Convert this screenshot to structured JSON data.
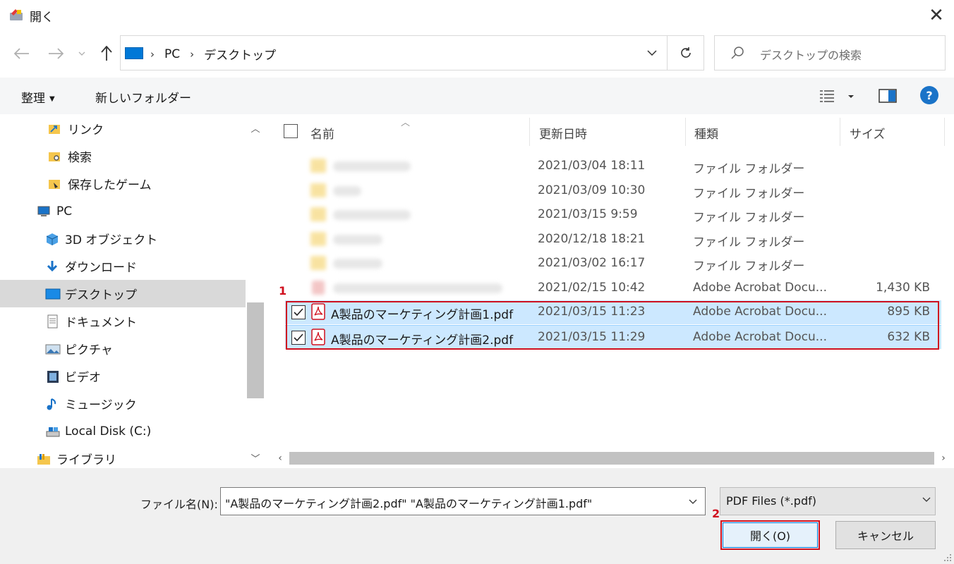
{
  "window": {
    "title": "開く",
    "close_glyph": "✕"
  },
  "address": {
    "crumbs": [
      "PC",
      "デスクトップ"
    ],
    "search_placeholder": "デスクトップの検索"
  },
  "toolbar": {
    "organize_label": "整理",
    "new_folder_label": "新しいフォルダー",
    "help_glyph": "?"
  },
  "nav": {
    "items": [
      {
        "label": "リンク",
        "icon": "links-folder-icon"
      },
      {
        "label": "検索",
        "icon": "search-folder-icon"
      },
      {
        "label": "保存したゲーム",
        "icon": "saved-games-icon"
      },
      {
        "label": "PC",
        "icon": "pc-icon"
      },
      {
        "label": "3D オブジェクト",
        "icon": "3d-objects-icon"
      },
      {
        "label": "ダウンロード",
        "icon": "downloads-icon"
      },
      {
        "label": "デスクトップ",
        "icon": "desktop-icon",
        "selected": true
      },
      {
        "label": "ドキュメント",
        "icon": "documents-icon"
      },
      {
        "label": "ピクチャ",
        "icon": "pictures-icon"
      },
      {
        "label": "ビデオ",
        "icon": "videos-icon"
      },
      {
        "label": "ミュージック",
        "icon": "music-icon"
      },
      {
        "label": "Local Disk (C:)",
        "icon": "local-disk-icon"
      },
      {
        "label": "ライブラリ",
        "icon": "libraries-icon"
      }
    ]
  },
  "columns": {
    "name": "名前",
    "date": "更新日時",
    "type": "種類",
    "size": "サイズ"
  },
  "files": [
    {
      "name": "",
      "date": "2021/03/04 18:11",
      "type": "ファイル フォルダー",
      "size": "",
      "kind": "folder",
      "blurred": true
    },
    {
      "name": "",
      "date": "2021/03/09 10:30",
      "type": "ファイル フォルダー",
      "size": "",
      "kind": "folder",
      "blurred": true
    },
    {
      "name": "",
      "date": "2021/03/15 9:59",
      "type": "ファイル フォルダー",
      "size": "",
      "kind": "folder",
      "blurred": true
    },
    {
      "name": "",
      "date": "2020/12/18 18:21",
      "type": "ファイル フォルダー",
      "size": "",
      "kind": "folder",
      "blurred": true
    },
    {
      "name": "",
      "date": "2021/03/02 16:17",
      "type": "ファイル フォルダー",
      "size": "",
      "kind": "folder",
      "blurred": true
    },
    {
      "name": "",
      "date": "2021/02/15 10:42",
      "type": "Adobe Acrobat Docu...",
      "size": "1,430 KB",
      "kind": "pdf",
      "blurred": true
    },
    {
      "name": "A製品のマーケティング計画1.pdf",
      "date": "2021/03/15 11:23",
      "type": "Adobe Acrobat Docu...",
      "size": "895 KB",
      "kind": "pdf",
      "selected": true
    },
    {
      "name": "A製品のマーケティング計画2.pdf",
      "date": "2021/03/15 11:29",
      "type": "Adobe Acrobat Docu...",
      "size": "632 KB",
      "kind": "pdf",
      "selected": true
    }
  ],
  "markers": {
    "step1": "1",
    "step2": "2"
  },
  "bottom": {
    "filename_label": "ファイル名(N):",
    "filename_value": "\"A製品のマーケティング計画2.pdf\" \"A製品のマーケティング計画1.pdf\"",
    "filter_value": "PDF Files (*.pdf)",
    "open_label": "開く(O)",
    "cancel_label": "キャンセル"
  },
  "colors": {
    "selection": "#cce8ff",
    "annotation": "#d0101e",
    "accent": "#0078d7"
  }
}
